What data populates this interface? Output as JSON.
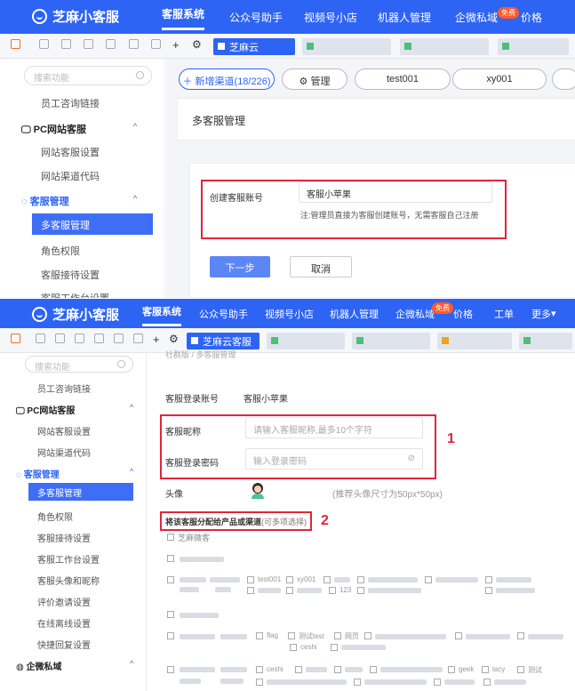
{
  "app": {
    "brand": "芝麻小客服",
    "nav": [
      "客服系统",
      "公众号助手",
      "视频号小店",
      "机器人管理",
      "企微私域",
      "价格",
      "工单",
      "更多"
    ],
    "free_badge": "免费",
    "more_caret": "▾"
  },
  "tabs": {
    "active": "芝麻云客服",
    "active_short": "芝麻云"
  },
  "sidebar": {
    "search_placeholder": "搜索功能",
    "items_top": [
      {
        "label": "员工咨询链接"
      },
      {
        "label": "PC网站客服",
        "group": true
      },
      {
        "label": "网站客服设置"
      },
      {
        "label": "网站渠道代码"
      },
      {
        "label": "客服管理",
        "group": true
      },
      {
        "label": "多客服管理",
        "selected": true
      },
      {
        "label": "角色权限"
      },
      {
        "label": "客服接待设置"
      },
      {
        "label": "客服工作台设置"
      }
    ],
    "items_bottom": [
      {
        "label": "员工咨询链接"
      },
      {
        "label": "PC网站客服",
        "group": true
      },
      {
        "label": "网站客服设置"
      },
      {
        "label": "网站渠道代码"
      },
      {
        "label": "客服管理",
        "group": true
      },
      {
        "label": "多客服管理",
        "selected": true
      },
      {
        "label": "角色权限"
      },
      {
        "label": "客服接待设置"
      },
      {
        "label": "客服工作台设置"
      },
      {
        "label": "客服头像和昵称"
      },
      {
        "label": "评价邀请设置"
      },
      {
        "label": "在线离线设置"
      },
      {
        "label": "快捷回复设置"
      },
      {
        "label": "企微私域",
        "group": true
      }
    ],
    "caret_up": "^"
  },
  "top_shot": {
    "add_channel": "新增渠道(18/226)",
    "manage": "管理",
    "channels": [
      "test001",
      "xy001"
    ],
    "page_title": "多客服管理",
    "form": {
      "label": "创建客服账号",
      "value": "客服小苹果",
      "note": "注:管理员直接为客服创建账号，无需客服自己注册"
    },
    "next_btn": "下一步",
    "cancel_btn": "取消"
  },
  "bottom_shot": {
    "breadcrumb": "社群版 / 多客服管理",
    "login_account_label": "客服登录账号",
    "login_account_value": "客服小苹果",
    "nickname_label": "客服昵称",
    "nickname_placeholder": "请输入客服昵称,最多10个字符",
    "password_label": "客服登录密码",
    "password_placeholder": "输入登录密码",
    "avatar_label": "头像",
    "avatar_hint": "(推荐头像尺寸为50px*50px)",
    "assign_label": "将该客服分配给产品或渠道",
    "assign_hint": "(可多项选择)",
    "marker_1": "1",
    "marker_2": "2",
    "product_1": "芝麻微客",
    "channels": [
      "test001",
      "xy001",
      "test",
      "123",
      "flag",
      "测试test",
      "网页",
      "ceshi",
      "geek",
      "lacy",
      "测试"
    ],
    "eye_icon": "⊘"
  },
  "colors": {
    "brand": "#2e64f4",
    "highlight": "#e1253b",
    "badge": "#ff5a2b"
  }
}
